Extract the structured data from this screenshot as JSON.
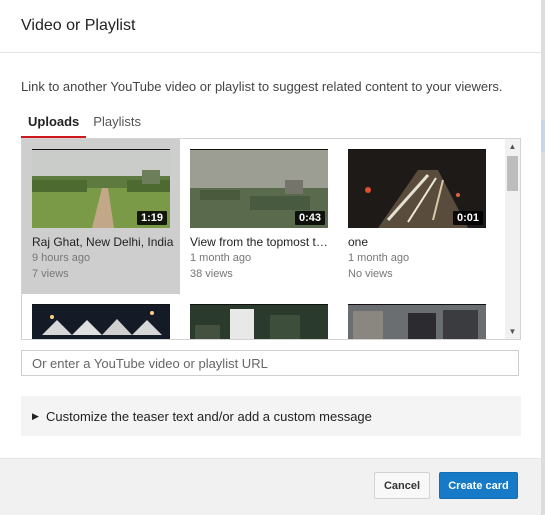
{
  "dialog": {
    "title": "Video or Playlist",
    "description": "Link to another YouTube video or playlist to suggest related content to your viewers."
  },
  "tabs": [
    {
      "label": "Uploads",
      "active": true
    },
    {
      "label": "Playlists",
      "active": false
    }
  ],
  "videos": [
    {
      "title": "Raj Ghat, New Delhi, India",
      "age": "9 hours ago",
      "views": "7 views",
      "duration": "1:19",
      "selected": true
    },
    {
      "title": "View from the topmost terrace",
      "age": "1 month ago",
      "views": "38 views",
      "duration": "0:43",
      "selected": false
    },
    {
      "title": "one",
      "age": "1 month ago",
      "views": "No views",
      "duration": "0:01",
      "selected": false
    },
    {
      "title": "",
      "age": "",
      "views": "",
      "duration": "",
      "selected": false
    },
    {
      "title": "",
      "age": "",
      "views": "",
      "duration": "",
      "selected": false
    },
    {
      "title": "",
      "age": "",
      "views": "",
      "duration": "",
      "selected": false
    }
  ],
  "url_input": {
    "placeholder": "Or enter a YouTube video or playlist URL",
    "value": ""
  },
  "customize": {
    "label": "Customize the teaser text and/or add a custom message"
  },
  "footer": {
    "cancel_label": "Cancel",
    "create_label": "Create card"
  },
  "colors": {
    "accent_red": "#cc181e",
    "primary_blue": "#167ac6",
    "selected_bg": "#cecece"
  }
}
